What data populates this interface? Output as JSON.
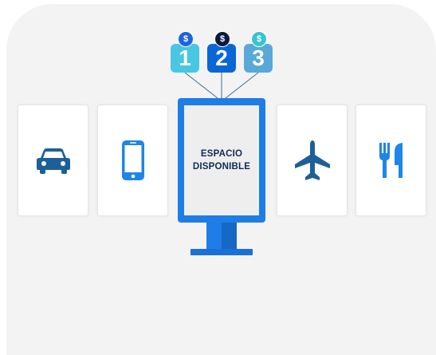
{
  "kiosk": {
    "line1": "ESPACIO",
    "line2": "DISPONIBLE"
  },
  "badges": [
    {
      "number": "1",
      "currency": "$",
      "color": "#48c6e2",
      "coin_color": "#1e63e0"
    },
    {
      "number": "2",
      "currency": "$",
      "color": "#0a66d6",
      "coin_color": "#0b1a3e"
    },
    {
      "number": "3",
      "currency": "$",
      "color": "#58a9d8",
      "coin_color": "#38c4d0"
    }
  ],
  "cards": [
    {
      "icon": "car-icon",
      "color": "#1d5f98"
    },
    {
      "icon": "smartphone-icon",
      "color": "#1e86e8"
    },
    {
      "icon": "airplane-icon",
      "color": "#1d5f98"
    },
    {
      "icon": "restaurant-icon",
      "color": "#1e86e8"
    }
  ],
  "colors": {
    "panel": "#f3f3f3",
    "kiosk": "#1e7de6",
    "wire": "#3f6f8f"
  }
}
